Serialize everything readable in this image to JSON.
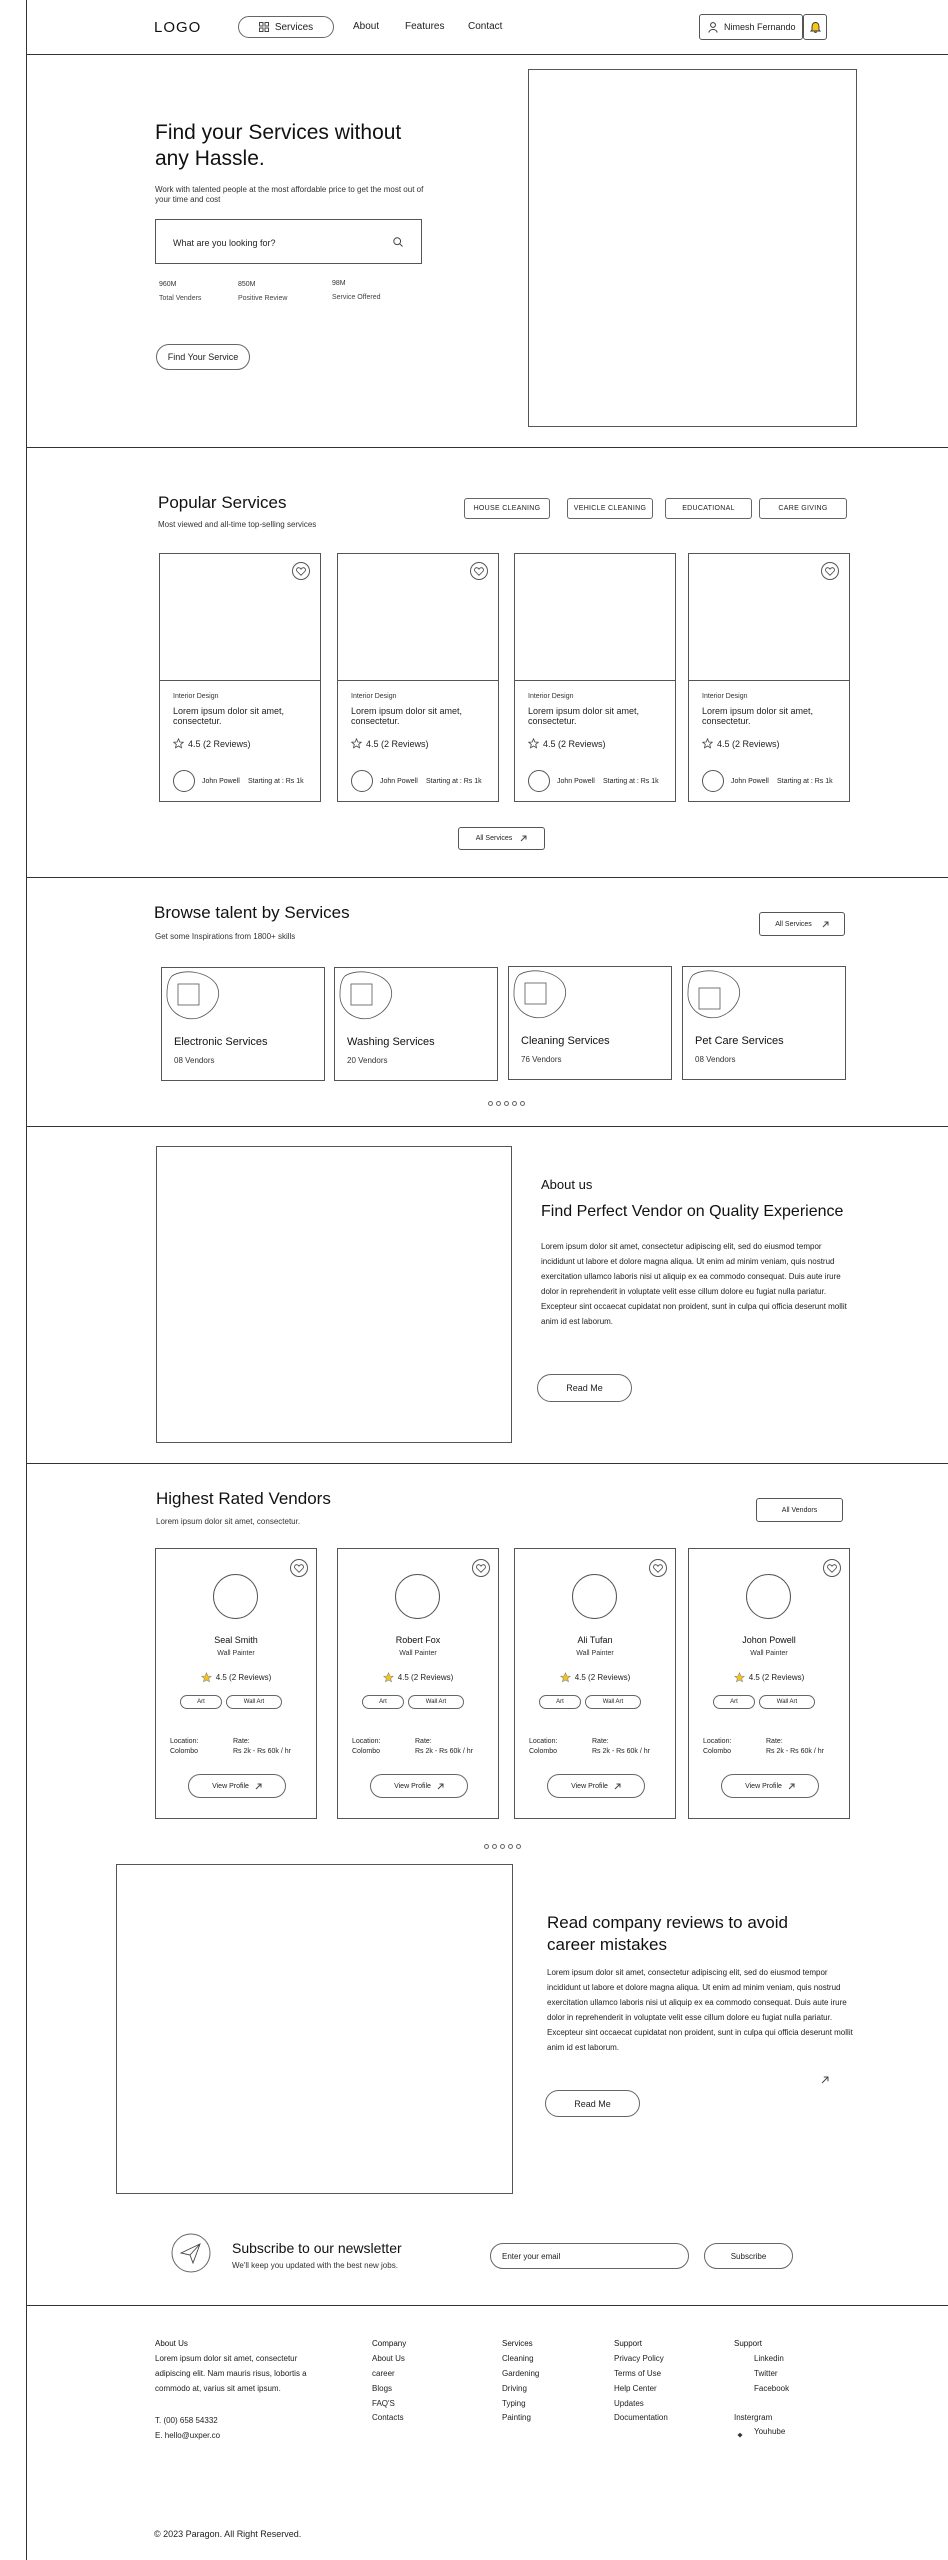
{
  "header": {
    "logo": "LOGO",
    "nav": {
      "services": "Services",
      "about": "About",
      "features": "Features",
      "contact": "Contact"
    },
    "user_name": "Nimesh Fernando"
  },
  "hero": {
    "title": "Find your Services  without any Hassle.",
    "subtitle": "Work with talented people at the most affordable price to get the most out of your time and cost",
    "search_placeholder": "What are you looking for?",
    "stats": [
      {
        "value": "960M",
        "label": "Total Venders"
      },
      {
        "value": "850M",
        "label": "Positive Review"
      },
      {
        "value": "98M",
        "label": "Service Offered"
      }
    ],
    "cta": "Find Your Service"
  },
  "popular": {
    "title": "Popular Services",
    "subtitle": "Most viewed and all-time top-selling services",
    "categories": [
      "HOUSE CLEANING",
      "VEHICLE CLEANING",
      "EDUCATIONAL",
      "CARE GIVING"
    ],
    "cards": [
      {
        "category": "Interior Design",
        "desc": "Lorem ipsum dolor sit amet, consectetur.",
        "rating": "4.5 (2 Reviews)",
        "author": "John Powell",
        "price": "Starting at : Rs 1k"
      },
      {
        "category": "Interior Design",
        "desc": "Lorem ipsum dolor sit amet, consectetur.",
        "rating": "4.5 (2 Reviews)",
        "author": "John Powell",
        "price": "Starting at : Rs 1k"
      },
      {
        "category": "Interior Design",
        "desc": "Lorem ipsum dolor sit amet, consectetur.",
        "rating": "4.5 (2 Reviews)",
        "author": "John Powell",
        "price": "Starting at : Rs 1k"
      },
      {
        "category": "Interior Design",
        "desc": "Lorem ipsum dolor sit amet, consectetur.",
        "rating": "4.5 (2 Reviews)",
        "author": "John Powell",
        "price": "Starting at : Rs 1k"
      }
    ],
    "all_services": "All Services"
  },
  "browse": {
    "title": "Browse talent by Services",
    "subtitle": "Get some Inspirations from 1800+ skills",
    "all_services": "All  Services",
    "items": [
      {
        "name": "Electronic Services",
        "count": "08 Vendors"
      },
      {
        "name": "Washing Services",
        "count": "20 Vendors"
      },
      {
        "name": "Cleaning Services",
        "count": "76 Vendors"
      },
      {
        "name": "Pet Care Services",
        "count": "08 Vendors"
      }
    ]
  },
  "about": {
    "kicker": "About us",
    "title": "Find Perfect Vendor on Quality Experience",
    "body": "Lorem ipsum dolor sit amet, consectetur adipiscing elit, sed do eiusmod tempor incididunt ut labore et dolore magna aliqua. Ut enim ad minim veniam, quis nostrud  exercitation ullamco laboris nisi ut aliquip ex ea commodo consequat. Duis aute irure dolor in reprehenderit in voluptate velit esse cillum dolore eu fugiat nulla pariatur. Excepteur sint occaecat cupidatat non proident, sunt in culpa qui officia deserunt mollit anim id est laborum.",
    "cta": "Read Me"
  },
  "vendors": {
    "title": "Highest Rated Vendors",
    "subtitle": "Lorem ipsum dolor sit amet, consectetur.",
    "all_vendors": "All Vendors",
    "items": [
      {
        "name": "Seal Smith",
        "role": "Wall Painter",
        "rating": "4.5 (2 Reviews)",
        "tag1": "Art",
        "tag2": "Wall Art",
        "location_label": "Location:",
        "location": "Colombo",
        "rate_label": "Rate:",
        "rate": "Rs 2k - Rs 60k / hr",
        "cta": "View Profile"
      },
      {
        "name": "Robert Fox",
        "role": "Wall Painter",
        "rating": "4.5 (2 Reviews)",
        "tag1": "Art",
        "tag2": "Wall Art",
        "location_label": "Location:",
        "location": "Colombo",
        "rate_label": "Rate:",
        "rate": "Rs 2k - Rs 60k / hr",
        "cta": "View Profile"
      },
      {
        "name": "Ali Tufan",
        "role": "Wall Painter",
        "rating": "4.5 (2 Reviews)",
        "tag1": "Art",
        "tag2": "Wall Art",
        "location_label": "Location:",
        "location": "Colombo",
        "rate_label": "Rate:",
        "rate": "Rs 2k - Rs 60k / hr",
        "cta": "View Profile"
      },
      {
        "name": "Johon Powell",
        "role": "Wall Painter",
        "rating": "4.5 (2 Reviews)",
        "tag1": "Art",
        "tag2": "Wall Art",
        "location_label": "Location:",
        "location": "Colombo",
        "rate_label": "Rate:",
        "rate": "Rs 2k - Rs 60k / hr",
        "cta": "View Profile"
      }
    ],
    "star_color": "#f5c518"
  },
  "reviews": {
    "title": "Read company reviews to avoid career mistakes",
    "body": "Lorem ipsum dolor sit amet, consectetur adipiscing elit, sed do eiusmod tempor incididunt ut labore et dolore magna aliqua. Ut enim ad minim veniam, quis nostrud  exercitation ullamco laboris nisi ut aliquip ex ea commodo consequat. Duis aute irure dolor in reprehenderit in voluptate velit esse cillum dolore eu fugiat nulla pariatur. Excepteur sint occaecat cupidatat non proident, sunt in culpa qui officia deserunt mollit anim id est laborum.",
    "cta": "Read Me"
  },
  "newsletter": {
    "title": "Subscribe to our newsletter",
    "subtitle": "We'll keep you updated with the best new jobs.",
    "placeholder": "Enter your email",
    "cta": "Subscribe"
  },
  "footer": {
    "about_heading": "About Us",
    "about_text": "Lorem ipsum dolor sit amet, consectetur adipiscing elit. Nam mauris risus, lobortis a commodo at, varius sit amet ipsum.",
    "phone": "T. (00) 658 54332",
    "email": "E. hello@uxper.co",
    "company": {
      "heading": "Company",
      "links": [
        "About Us",
        "career",
        "Blogs",
        "FAQ'S",
        "Contacts"
      ]
    },
    "services": {
      "heading": "Services",
      "links": [
        "Cleaning",
        "Gardening",
        "Driving",
        "Typing",
        "Painting"
      ]
    },
    "support": {
      "heading": "Support",
      "links": [
        "Privacy Policy",
        "Terms of Use",
        "Help Center",
        "Updates",
        "Documentation"
      ]
    },
    "social": {
      "heading": "Support",
      "links": [
        "Linkedin",
        "Twitter",
        "Facebook"
      ],
      "instagram": "Instergram",
      "youtube": "Youhube"
    },
    "copyright": "© 2023 Paragon. All Right Reserved."
  }
}
